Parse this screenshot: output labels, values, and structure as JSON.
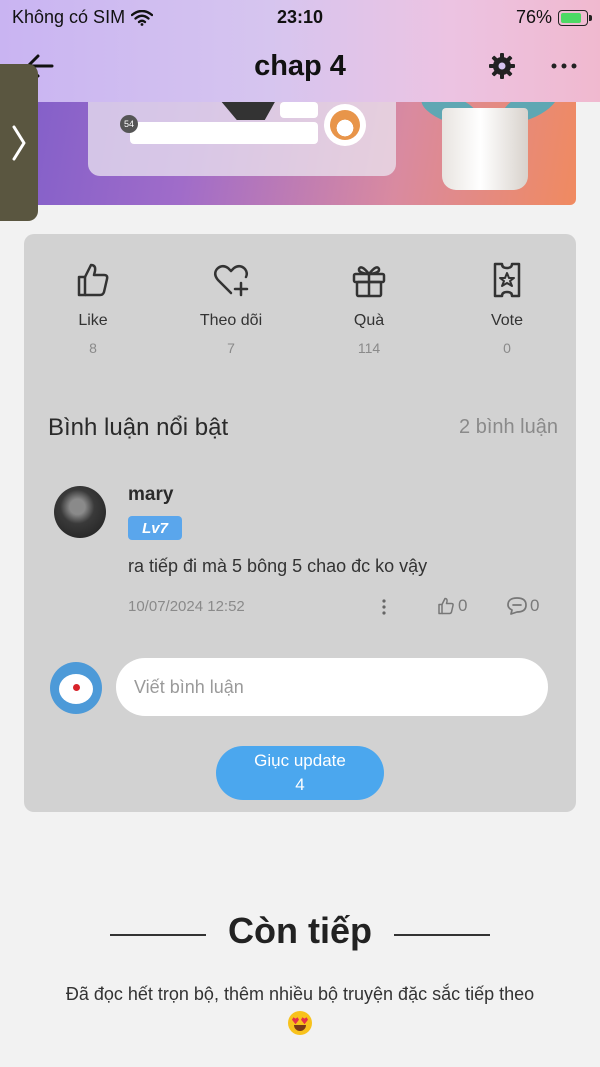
{
  "status_bar": {
    "carrier": "Không có SIM",
    "time": "23:10",
    "battery": "76%"
  },
  "nav": {
    "title": "chap 4"
  },
  "banner": {
    "badge": "54"
  },
  "actions": [
    {
      "label": "Like",
      "count": "8",
      "icon": "thumbs-up-icon"
    },
    {
      "label": "Theo dõi",
      "count": "7",
      "icon": "heart-plus-icon"
    },
    {
      "label": "Quà",
      "count": "114",
      "icon": "gift-icon"
    },
    {
      "label": "Vote",
      "count": "0",
      "icon": "ticket-star-icon"
    }
  ],
  "comments_section": {
    "title": "Bình luận nổi bật",
    "count_label": "2 bình luận",
    "comments": [
      {
        "user": "mary",
        "level": "Lv7",
        "text": "ra tiếp đi mà 5 bông 5 chao đc ko vậy",
        "date": "10/07/2024 12:52",
        "likes": "0",
        "replies": "0"
      }
    ],
    "composer_placeholder": "Viết bình luận",
    "urge_label": "Giục update",
    "urge_count": "4"
  },
  "footer": {
    "title": "Còn tiếp",
    "description": "Đã đọc hết trọn bộ, thêm nhiều bộ truyện đặc sắc tiếp theo"
  },
  "colors": {
    "accent": "#4ba7ee",
    "level_badge": "#5aa6ec",
    "card_bg": "#d2d2d2"
  }
}
